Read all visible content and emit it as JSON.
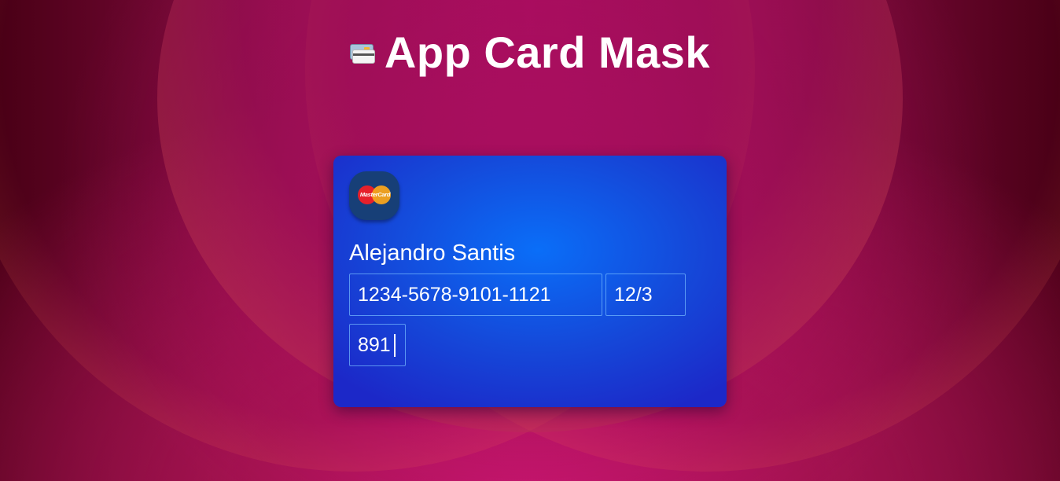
{
  "page": {
    "title": "App Card Mask",
    "title_icon": "credit-cards-icon"
  },
  "card": {
    "brand": "MasterCard",
    "brand_icon": "mastercard-logo-icon",
    "holder_name": "Alejandro Santis",
    "number_value": "1234-5678-9101-1121",
    "expiry_value": "12/3",
    "cvv_value": "891"
  },
  "colors": {
    "background_primary": "#9d1056",
    "card_primary": "#0a6ef8",
    "card_secondary": "#1c28c8",
    "badge": "#173f77",
    "text": "#ffffff"
  }
}
